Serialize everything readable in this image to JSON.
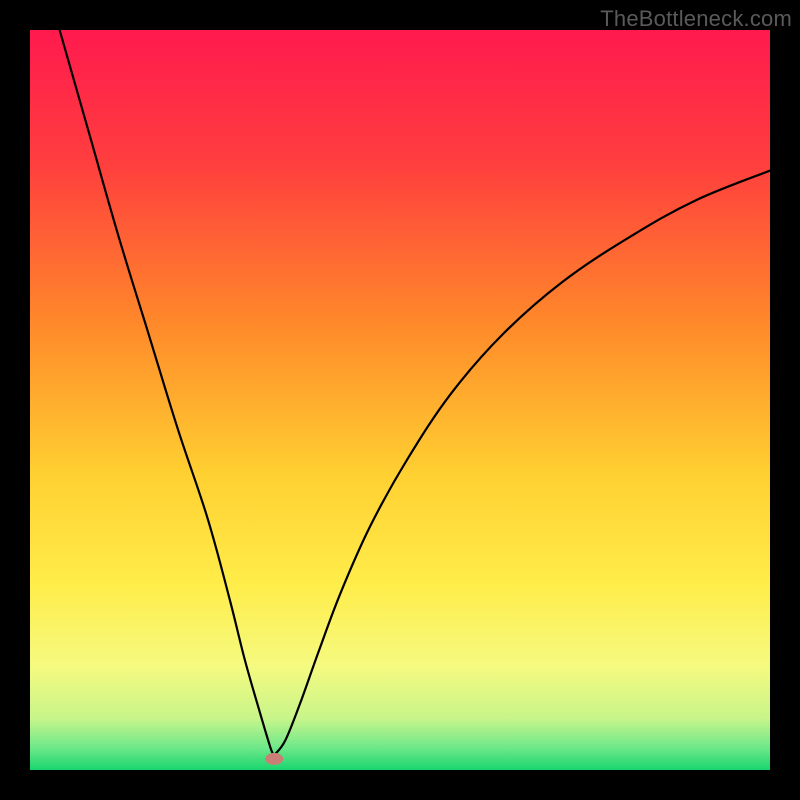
{
  "watermark": "TheBottleneck.com",
  "chart_data": {
    "type": "line",
    "title": "",
    "xlabel": "",
    "ylabel": "",
    "xlim": [
      0,
      100
    ],
    "ylim": [
      0,
      100
    ],
    "gradient_stops": [
      {
        "offset": 0,
        "color": "#ff1a4e"
      },
      {
        "offset": 18,
        "color": "#ff3e3e"
      },
      {
        "offset": 40,
        "color": "#ff8a2a"
      },
      {
        "offset": 60,
        "color": "#ffd031"
      },
      {
        "offset": 75,
        "color": "#ffed4a"
      },
      {
        "offset": 86,
        "color": "#f5fa80"
      },
      {
        "offset": 93,
        "color": "#c8f58a"
      },
      {
        "offset": 97,
        "color": "#6ee88a"
      },
      {
        "offset": 100,
        "color": "#18d66e"
      }
    ],
    "vertex": {
      "x": 33,
      "y": 2
    },
    "marker": {
      "x": 33,
      "y": 1.5,
      "color": "#c97f76"
    },
    "series": [
      {
        "name": "left-branch",
        "x": [
          4,
          8,
          12,
          16,
          20,
          24,
          27,
          29,
          31,
          32.5,
          33
        ],
        "values": [
          100,
          86,
          72,
          59,
          46,
          34,
          23,
          15,
          8,
          3,
          2
        ]
      },
      {
        "name": "right-branch",
        "x": [
          33,
          34.5,
          36.5,
          39,
          42,
          46,
          51,
          57,
          64,
          72,
          81,
          90,
          100
        ],
        "values": [
          2,
          4,
          9,
          16,
          24,
          33,
          42,
          51,
          59,
          66,
          72,
          77,
          81
        ]
      }
    ]
  }
}
